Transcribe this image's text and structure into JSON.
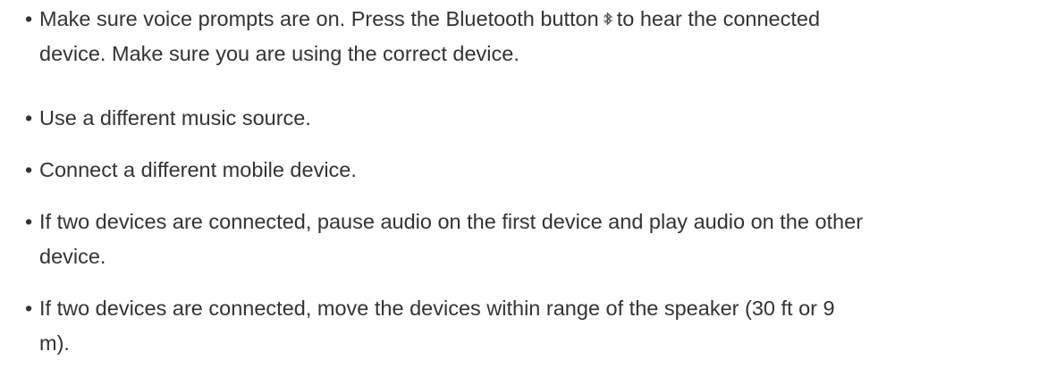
{
  "icons": {
    "bluetooth": "bluetooth-icon"
  },
  "colors": {
    "text": "#333333",
    "background": "#ffffff"
  },
  "items": [
    {
      "line1_before": "Make sure voice prompts are on. Press the Bluetooth button",
      "line1_after": "to hear the connected",
      "line2": "device. Make sure you are using the correct device."
    },
    {
      "line1": "Use a different music source."
    },
    {
      "line1": "Connect a different mobile device."
    },
    {
      "line1": "If two devices are connected, pause audio on the first device and play audio on the other",
      "line2": "device."
    },
    {
      "line1": "If two devices are connected, move the devices within range of the speaker (30 ft or 9",
      "line2": "m)."
    }
  ]
}
